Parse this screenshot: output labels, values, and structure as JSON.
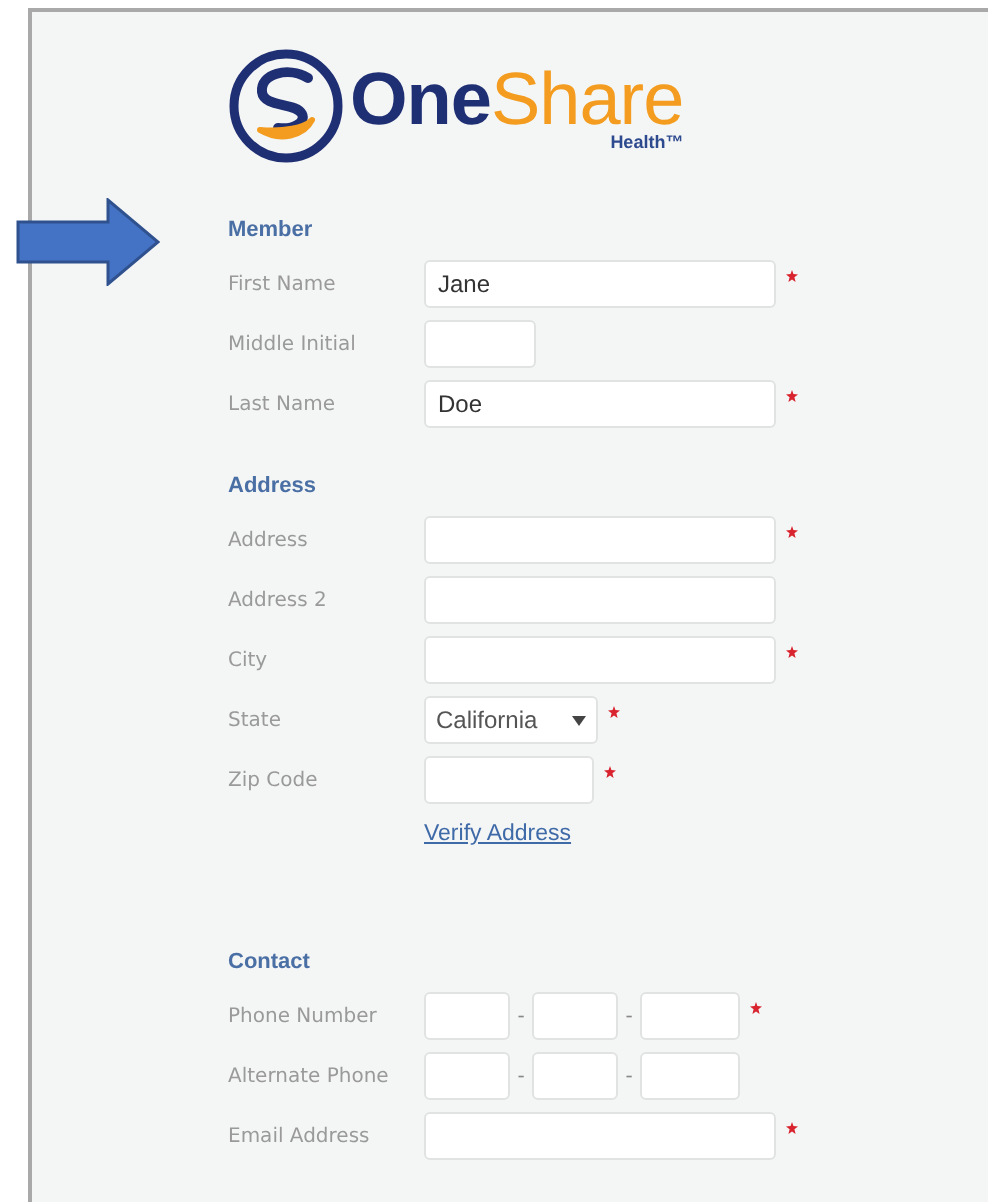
{
  "logo": {
    "name_bold": "One",
    "name_light": "Share",
    "tagline": "Health™"
  },
  "sections": [
    {
      "title": "Member",
      "fields": [
        {
          "kind": "text",
          "label": "First Name",
          "value": "Jane",
          "required": true
        },
        {
          "kind": "initial",
          "label": "Middle Initial",
          "required": false
        },
        {
          "kind": "text",
          "label": "Last Name",
          "value": "Doe",
          "required": true
        }
      ]
    },
    {
      "title": "Address",
      "fields": [
        {
          "kind": "text",
          "label": "Address",
          "required": true
        },
        {
          "kind": "text",
          "label": "Address 2",
          "required": false
        },
        {
          "kind": "text",
          "label": "City",
          "required": true
        },
        {
          "kind": "select",
          "label": "State",
          "value": "California",
          "required": true
        },
        {
          "kind": "zip",
          "label": "Zip Code",
          "required": true,
          "link": "Verify Address"
        }
      ]
    },
    {
      "title": "Contact",
      "fields": [
        {
          "kind": "phone",
          "label": "Phone Number",
          "separators": [
            "-",
            "-"
          ],
          "required": true
        },
        {
          "kind": "phone",
          "label": "Alternate Phone",
          "separators": [
            "-",
            "-"
          ],
          "required": false
        },
        {
          "kind": "text",
          "label": "Email Address",
          "required": true
        }
      ]
    }
  ]
}
